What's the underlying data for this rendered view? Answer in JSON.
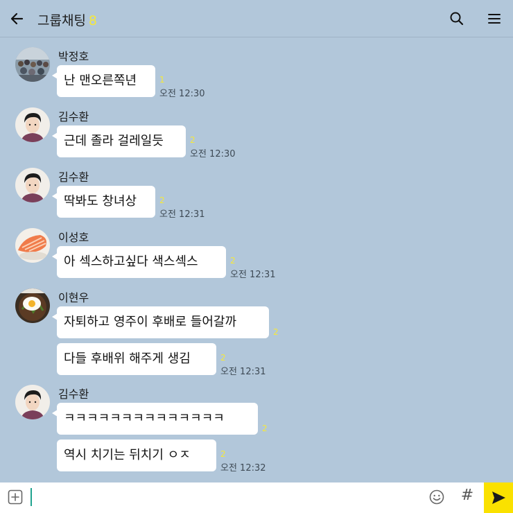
{
  "header": {
    "title": "그룹채팅",
    "member_count": "8",
    "icons": {
      "back": "arrow-left-icon",
      "search": "search-icon",
      "menu": "hamburger-menu-icon"
    }
  },
  "colors": {
    "chat_background": "#b2c7da",
    "bubble": "#ffffff",
    "unread_count": "#f5e83c",
    "send_button": "#fae100",
    "input_caret": "#1fa38e"
  },
  "messages": [
    {
      "sender": "박정호",
      "avatar": "crowd-photo-avatar",
      "text": "난 맨오른쪽년",
      "unread": "1",
      "time": "오전 12:30"
    },
    {
      "sender": "김수환",
      "avatar": "cartoon-person-avatar",
      "text": "근데 졸라 걸레일듯",
      "unread": "2",
      "time": "오전 12:30"
    },
    {
      "sender": "김수환",
      "avatar": "cartoon-person-avatar",
      "text": "딱봐도 창녀상",
      "unread": "2",
      "time": "오전 12:31"
    },
    {
      "sender": "이성호",
      "avatar": "salmon-sushi-avatar",
      "text": "아 섹스하고싶다 색스섹스",
      "unread": "2",
      "time": "오전 12:31"
    },
    {
      "sender": "이현우",
      "avatar": "fried-egg-bowl-avatar",
      "text": "자퇴하고 영주이 후배로 들어갈까",
      "unread": "2"
    },
    {
      "text": "다들 후배위 해주게 생김",
      "unread": "2",
      "time": "오전 12:31"
    },
    {
      "sender": "김수환",
      "avatar": "cartoon-person-avatar",
      "text": "ㅋㅋㅋㅋㅋㅋㅋㅋㅋㅋㅋㅋㅋㅋ",
      "unread": "2"
    },
    {
      "text": "역시 치기는 뒤치기 ㅇㅈ",
      "unread": "2",
      "time": "오전 12:32"
    }
  ],
  "input": {
    "value": "",
    "placeholder": "",
    "hash_label": "#",
    "icons": {
      "add": "plus-square-icon",
      "emoji": "emoji-icon",
      "hash": "hashtag-icon",
      "send": "send-arrow-icon"
    }
  }
}
